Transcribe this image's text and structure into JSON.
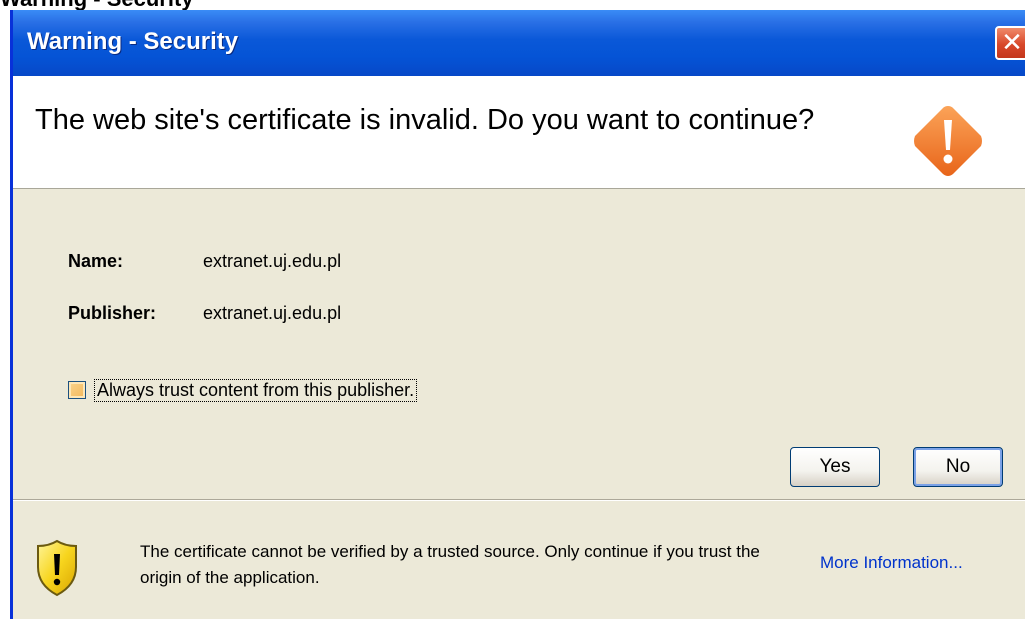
{
  "background_window": {
    "title_fragment": "Warning - Security"
  },
  "dialog": {
    "title": "Warning - Security",
    "close_glyph": "✕",
    "question": "The web site's certificate is invalid.  Do you want to continue?",
    "header_icon": "warning-diamond-icon",
    "fields": {
      "name_label": "Name:",
      "name_value": "extranet.uj.edu.pl",
      "publisher_label": "Publisher:",
      "publisher_value": "extranet.uj.edu.pl"
    },
    "checkbox": {
      "label": "Always trust content from this publisher.",
      "checked": false
    },
    "buttons": {
      "yes": "Yes",
      "no": "No"
    },
    "footer": {
      "icon": "shield-warning-icon",
      "text": "The certificate cannot be verified by a trusted source.  Only continue if you trust the origin of the application.",
      "more_info": "More Information..."
    }
  },
  "colors": {
    "titlebar": "#0554d6",
    "body": "#ece9d8",
    "link": "#0033cc",
    "warning_orange": "#f07a24",
    "shield_yellow": "#f7d51e"
  }
}
